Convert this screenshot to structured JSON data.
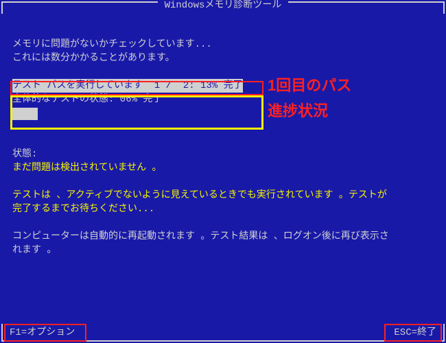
{
  "header": {
    "title": "Windowsメモリ診断ツール"
  },
  "intro": {
    "line1": "メモリに問題がないかチェックしています...",
    "line2": "これには数分かかることがあります。"
  },
  "test": {
    "pass_line": "テスト パスを実行しています  1 /  2: 13% 完了",
    "overall_label": "全体的なテストの状態: 06% 完了",
    "progress_percent": 6
  },
  "status": {
    "label": "状態:",
    "no_problems": "まだ問題は検出されていません 。"
  },
  "notice": {
    "running1": "テストは 、アクティブでないように見えているときでも実行されています 。テストが",
    "running2": "完了するまでお待ちください...",
    "restart1": "コンピューターは自動的に再起動されます 。テスト結果は 、ログオン後に再び表示さ",
    "restart2": "れます 。"
  },
  "footer": {
    "f1": "F1=オプション",
    "esc": "ESC=終了"
  },
  "annotations": {
    "line1": "1回目のパス",
    "line2": "進捗状況"
  }
}
